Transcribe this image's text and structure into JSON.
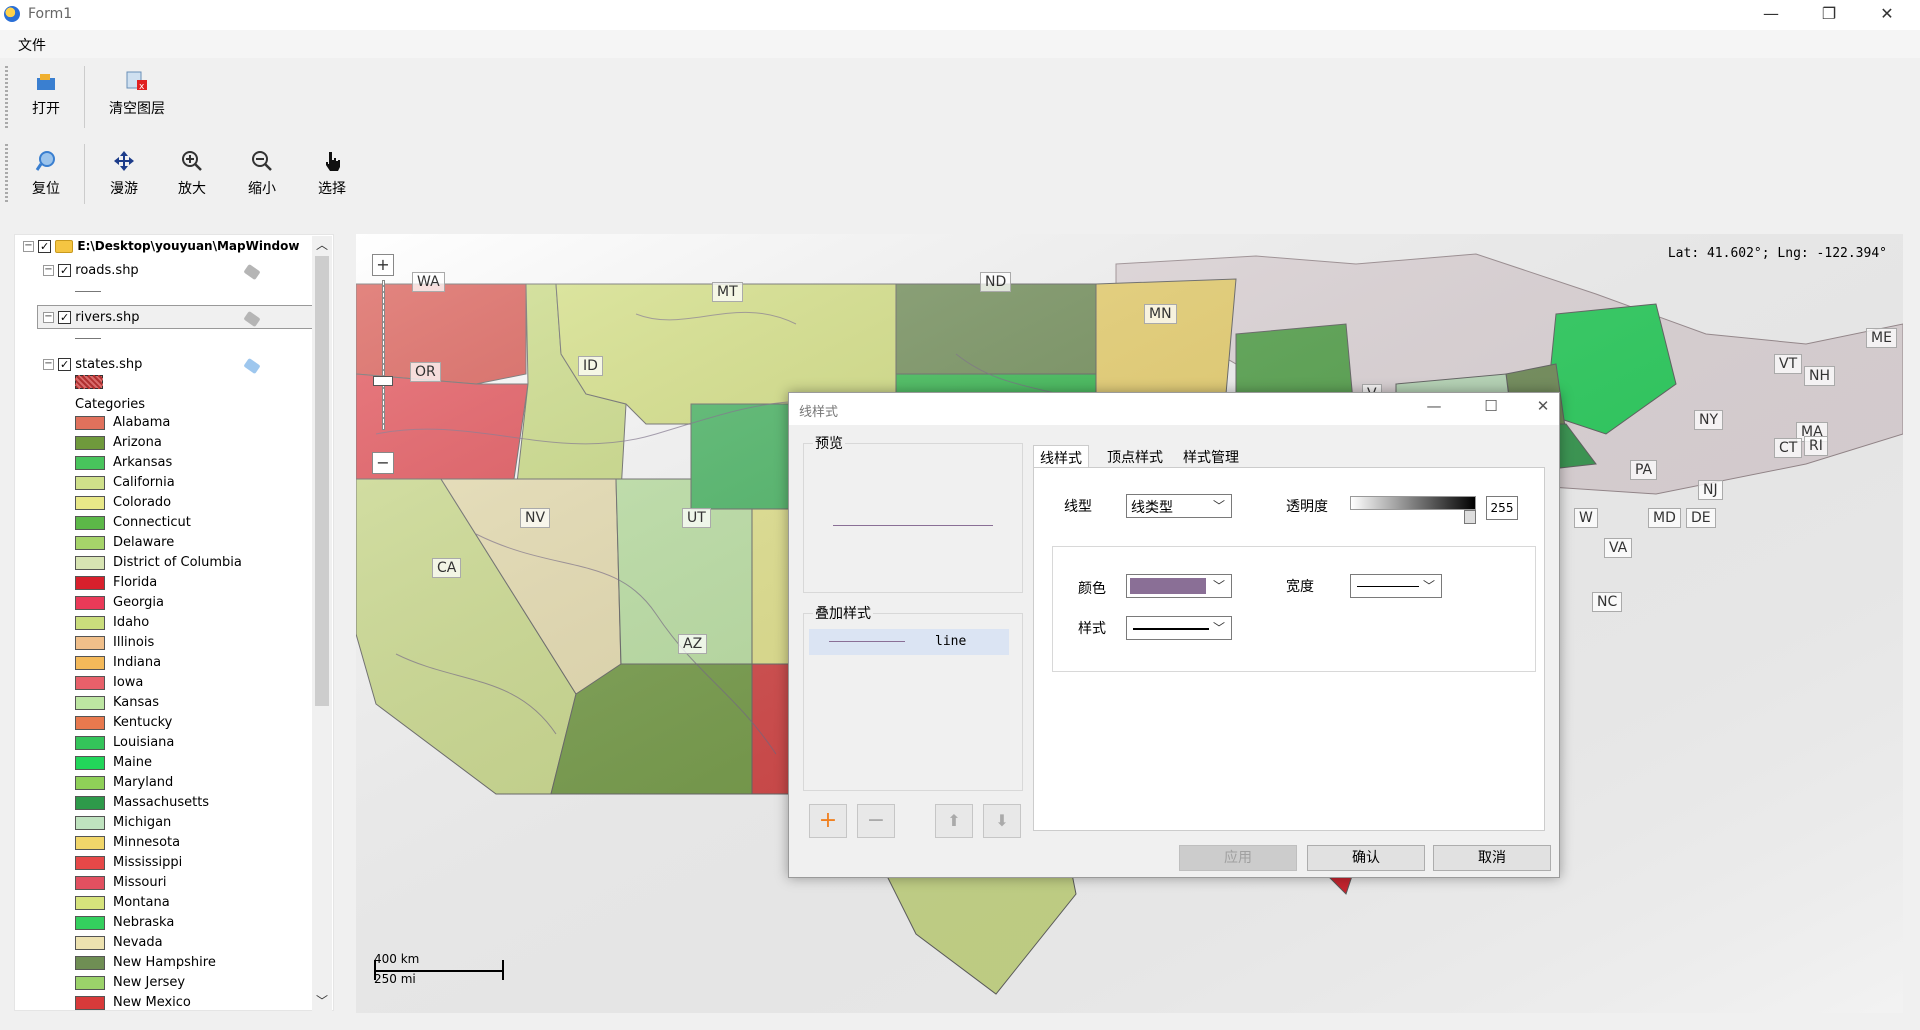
{
  "window": {
    "title": "Form1",
    "min": "—",
    "max": "❐",
    "close": "✕"
  },
  "menu": {
    "file": "文件"
  },
  "toolbar1": {
    "open": "打开",
    "clear": "清空图层"
  },
  "toolbar2": {
    "reset": "复位",
    "pan": "漫游",
    "zoom_in": "放大",
    "zoom_out": "缩小",
    "select": "选择"
  },
  "tree": {
    "root": "E:\\Desktop\\youyuan\\MapWindow",
    "layers": [
      "roads.shp",
      "rivers.shp",
      "states.shp"
    ],
    "categories_label": "Categories",
    "categories": [
      {
        "name": "Alabama",
        "color": "#e0715c"
      },
      {
        "name": "Arizona",
        "color": "#6f9a3c"
      },
      {
        "name": "Arkansas",
        "color": "#48c45c"
      },
      {
        "name": "California",
        "color": "#cfe08a"
      },
      {
        "name": "Colorado",
        "color": "#e8e888"
      },
      {
        "name": "Connecticut",
        "color": "#5cb848"
      },
      {
        "name": "Delaware",
        "color": "#a6d46a"
      },
      {
        "name": "District of Columbia",
        "color": "#d7e4b2"
      },
      {
        "name": "Florida",
        "color": "#d8202c"
      },
      {
        "name": "Georgia",
        "color": "#ea3a58"
      },
      {
        "name": "Idaho",
        "color": "#cadd7c"
      },
      {
        "name": "Illinois",
        "color": "#f0bf8a"
      },
      {
        "name": "Indiana",
        "color": "#f4b95a"
      },
      {
        "name": "Iowa",
        "color": "#e8606a"
      },
      {
        "name": "Kansas",
        "color": "#bde6a2"
      },
      {
        "name": "Kentucky",
        "color": "#e8794e"
      },
      {
        "name": "Louisiana",
        "color": "#34c45a"
      },
      {
        "name": "Maine",
        "color": "#22d65a"
      },
      {
        "name": "Maryland",
        "color": "#8fd058"
      },
      {
        "name": "Massachusetts",
        "color": "#2e9a4a"
      },
      {
        "name": "Michigan",
        "color": "#bfe3bf"
      },
      {
        "name": "Minnesota",
        "color": "#f1d66a"
      },
      {
        "name": "Mississippi",
        "color": "#e64848"
      },
      {
        "name": "Missouri",
        "color": "#e25060"
      },
      {
        "name": "Montana",
        "color": "#d6e37c"
      },
      {
        "name": "Nebraska",
        "color": "#34cf5e"
      },
      {
        "name": "Nevada",
        "color": "#ede2b0"
      },
      {
        "name": "New Hampshire",
        "color": "#6f8e54"
      },
      {
        "name": "New Jersey",
        "color": "#9bd26a"
      },
      {
        "name": "New Mexico",
        "color": "#d83a3a"
      }
    ]
  },
  "map": {
    "coord": "Lat: 41.602°; Lng: -122.394°",
    "scale_km": "400 km",
    "scale_mi": "250 mi",
    "states": [
      "WA",
      "OR",
      "ID",
      "MT",
      "ND",
      "MN",
      "NV",
      "UT",
      "CA",
      "AZ",
      "ME",
      "VT",
      "NH",
      "NY",
      "MA",
      "CT",
      "RI",
      "PA",
      "NJ",
      "MD",
      "DE",
      "VA",
      "NC",
      "V",
      "W"
    ]
  },
  "dialog": {
    "title": "线样式",
    "preview_label": "预览",
    "overlay_label": "叠加样式",
    "overlay_item": "line",
    "tabs": [
      "线样式",
      "顶点样式",
      "样式管理"
    ],
    "line_type_label": "线型",
    "line_type_value": "线类型",
    "opacity_label": "透明度",
    "opacity_value": "255",
    "color_label": "颜色",
    "width_label": "宽度",
    "style_label": "样式",
    "apply": "应用",
    "ok": "确认",
    "cancel": "取消"
  }
}
